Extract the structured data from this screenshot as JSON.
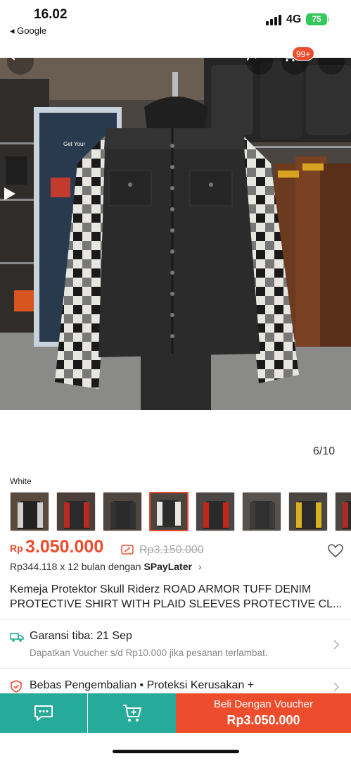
{
  "status_bar": {
    "time": "16.02",
    "back_app": "◂ Google",
    "network": "4G",
    "battery": "75"
  },
  "gallery": {
    "cart_badge": "99+",
    "counter": "6/10",
    "banner_text": "Get Your"
  },
  "variants": {
    "label": "White",
    "thumbnails": [
      "thumb-1",
      "thumb-2",
      "thumb-3",
      "thumb-4",
      "thumb-5",
      "thumb-6",
      "thumb-7",
      "thumb-8"
    ],
    "selected_index": 3
  },
  "price": {
    "currency": "Rp",
    "current": "3.050.000",
    "original": "Rp3.150.000",
    "installment_text": "Rp344.118 x 12 bulan dengan ",
    "installment_brand": "SPayLater",
    "chevron": "›"
  },
  "product": {
    "title": "Kemeja Protektor Skull Riderz ROAD ARMOR TUFF DENIM PROTECTIVE SHIRT WITH PLAID SLEEVES PROTECTIVE CL..."
  },
  "shipping": {
    "main": "Garansi tiba: 21 Sep",
    "sub": "Dapatkan Voucher s/d Rp10.000 jika pesanan terlambat."
  },
  "returns": {
    "main": "Bebas Pengembalian  •  Proteksi Kerusakan +"
  },
  "bottom_bar": {
    "buy_label": "Beli Dengan Voucher",
    "buy_price": "Rp3.050.000"
  },
  "colors": {
    "brand_orange": "#ee4d2d",
    "teal": "#26aa99",
    "battery_green": "#34c759"
  }
}
